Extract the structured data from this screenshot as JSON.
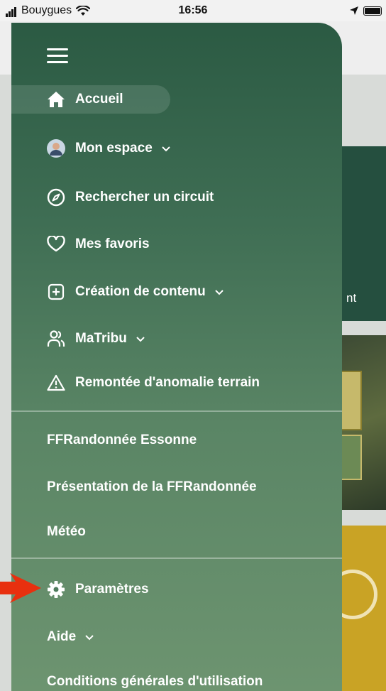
{
  "status_bar": {
    "carrier": "Bouygues",
    "time": "16:56"
  },
  "background": {
    "card_partial_text": "nt"
  },
  "menu": {
    "primary": [
      {
        "label": "Accueil",
        "icon": "home-icon",
        "has_chevron": false,
        "active": true
      },
      {
        "label": "Mon espace",
        "icon": "avatar",
        "has_chevron": true
      },
      {
        "label": "Rechercher un circuit",
        "icon": "compass-icon",
        "has_chevron": false
      },
      {
        "label": "Mes favoris",
        "icon": "heart-icon",
        "has_chevron": false
      },
      {
        "label": "Création de contenu",
        "icon": "plus-square-icon",
        "has_chevron": true
      },
      {
        "label": "MaTribu",
        "icon": "users-icon",
        "has_chevron": true
      },
      {
        "label": "Remontée d'anomalie terrain",
        "icon": "warning-icon",
        "has_chevron": false
      }
    ],
    "secondary": [
      {
        "label": "FFRandonnée Essonne"
      },
      {
        "label": "Présentation de la FFRandonnée"
      },
      {
        "label": "Météo"
      }
    ],
    "settings_label": "Paramètres",
    "help_label": "Aide",
    "terms_label": "Conditions générales d'utilisation"
  },
  "colors": {
    "drawer_top": "#2b5a43",
    "drawer_bottom": "#6d9470",
    "annotation_arrow": "#e8300f"
  }
}
